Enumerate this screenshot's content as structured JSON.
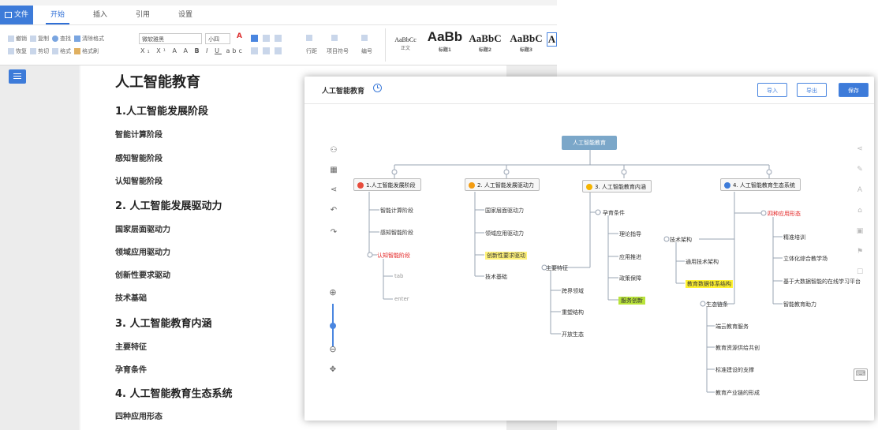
{
  "word": {
    "tabs": {
      "file": "文件",
      "home": "开始",
      "insert": "插入",
      "references": "引用",
      "settings": "设置"
    },
    "ribbon": {
      "undo": "撤销",
      "redo": "恢复",
      "cut": "剪切",
      "copy": "复制",
      "format_painter_short": "格式",
      "find": "查找",
      "clear_format": "清除格式",
      "format_brush": "格式刷",
      "font_name": "微软雅黑",
      "font_size": "小四",
      "line_spacing": "行距",
      "bullets": "项目符号",
      "numbering": "编号",
      "styles": [
        {
          "preview": "AaBbCc",
          "name": "正文"
        },
        {
          "preview": "AaBb",
          "name": "标题1"
        },
        {
          "preview": "AaBbC",
          "name": "标题2"
        },
        {
          "preview": "AaBbC",
          "name": "标题3"
        },
        {
          "preview": "A",
          "name": ""
        }
      ]
    },
    "document": {
      "title": "人工智能教育",
      "lines": [
        {
          "kind": "h2",
          "text": "1.人工智能发展阶段"
        },
        {
          "kind": "body",
          "text": "智能计算阶段"
        },
        {
          "kind": "body",
          "text": "感知智能阶段"
        },
        {
          "kind": "body",
          "text": "认知智能阶段"
        },
        {
          "kind": "h2",
          "text": "2. 人工智能发展驱动力"
        },
        {
          "kind": "body",
          "text": "国家层面驱动力"
        },
        {
          "kind": "body",
          "text": "领域应用驱动力"
        },
        {
          "kind": "body",
          "text": "创新性要求驱动"
        },
        {
          "kind": "body",
          "text": "技术基础"
        },
        {
          "kind": "h2",
          "text": "3. 人工智能教育内涵"
        },
        {
          "kind": "body",
          "text": "主要特征"
        },
        {
          "kind": "body",
          "text": "孕育条件"
        },
        {
          "kind": "h2",
          "text": "4. 人工智能教育生态系统"
        },
        {
          "kind": "body",
          "text": "四种应用形态"
        }
      ]
    }
  },
  "mindmap": {
    "title": "人工智能教育",
    "buttons": {
      "import": "导入",
      "export": "导出",
      "save": "保存"
    },
    "root": "人工智能教育",
    "branches": [
      {
        "label": "1.人工智能发展阶段",
        "color": "#e74c3c"
      },
      {
        "label": "2. 人工智能发展驱动力",
        "color": "#f39c12"
      },
      {
        "label": "3. 人工智能教育内涵",
        "color": "#f5b400"
      },
      {
        "label": "4. 人工智能教育生态系统",
        "color": "#3d7bd9"
      }
    ],
    "b1": {
      "c1": "智能计算阶段",
      "c2": "感知智能阶段",
      "c3": "认知智能阶段",
      "tab": "tab",
      "enter": "enter"
    },
    "b2": {
      "c1": "国家层面驱动力",
      "c2": "领域应用驱动力",
      "c3": "创新性要求驱动",
      "c4": "技术基础"
    },
    "b3": {
      "g1": "孕育条件",
      "g1c": [
        "理论指导",
        "应用推进",
        "政策保障",
        "服务创新"
      ],
      "g2": "主要特征",
      "g2c": [
        "跨界领域",
        "重塑结构",
        "开放生态"
      ]
    },
    "b4": {
      "g1": "四种应用形态",
      "g1c": [
        "精准培训",
        "立体化综合教学场",
        "基于大数据智能的在线学习平台",
        "智能教育助力"
      ],
      "g2": "技术架构",
      "g2c": [
        "通用技术架构",
        "教育数据体系结构"
      ],
      "g3": "生态链条",
      "g3c": [
        "端云教育服务",
        "教育资源供给共创",
        "标准建设的支撑",
        "教育产业链的形成"
      ]
    }
  }
}
